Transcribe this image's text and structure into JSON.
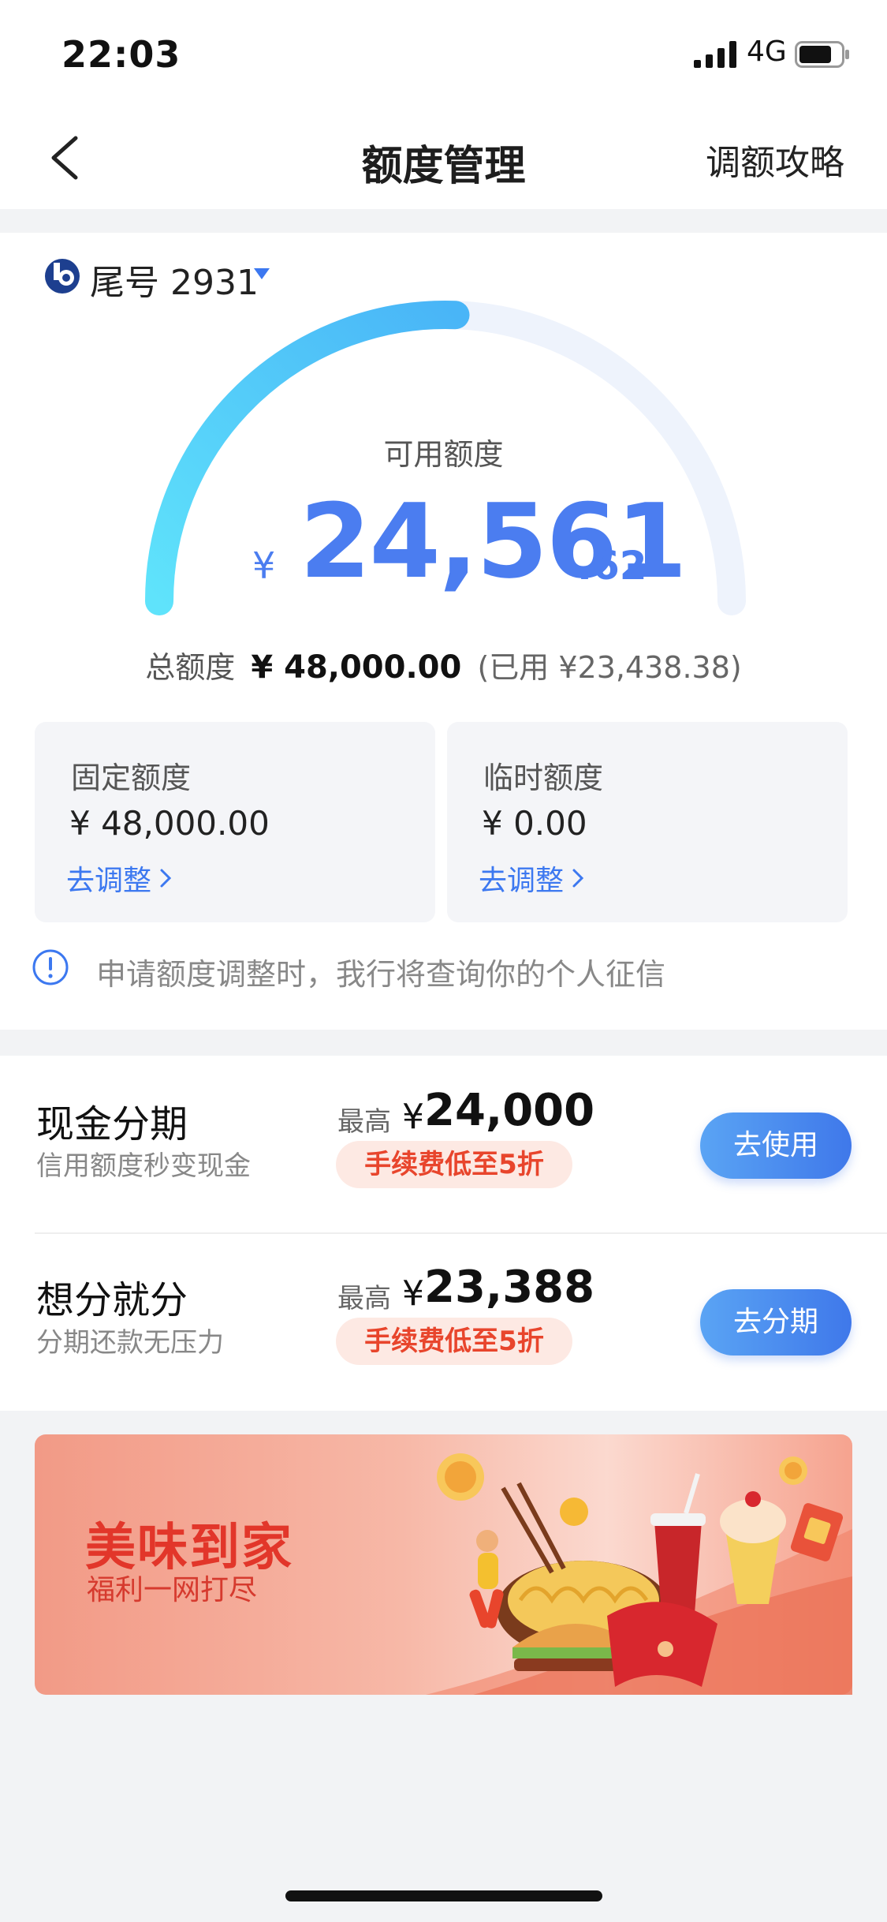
{
  "status_bar": {
    "time": "22:03",
    "network": "4G"
  },
  "nav": {
    "title": "额度管理",
    "right_link": "调额攻略"
  },
  "account": {
    "label": "尾号 2931"
  },
  "credit": {
    "available_label": "可用额度",
    "currency": "¥",
    "available_integer": "24,561",
    "available_decimal": ".62",
    "available_fraction_of_total": 0.511,
    "total_label": "总额度",
    "total_value": "¥ 48,000.00",
    "used_text": "(已用 ¥23,438.38)"
  },
  "limits": [
    {
      "title": "固定额度",
      "value": "¥ 48,000.00",
      "link": "去调整"
    },
    {
      "title": "临时额度",
      "value": "¥ 0.00",
      "link": "去调整"
    }
  ],
  "notice": "申请额度调整时，我行将查询你的个人征信",
  "products": [
    {
      "title": "现金分期",
      "subtitle": "信用额度秒变现金",
      "max_label": "最高",
      "max_currency": "¥",
      "max_value": "24,000",
      "promo": "手续费低至5折",
      "button": "去使用"
    },
    {
      "title": "想分就分",
      "subtitle": "分期还款无压力",
      "max_label": "最高",
      "max_currency": "¥",
      "max_value": "23,388",
      "promo": "手续费低至5折",
      "button": "去分期"
    }
  ],
  "banner": {
    "title": "美味到家",
    "subtitle": "福利一网打尽"
  },
  "colors": {
    "accent_blue": "#4b7df0",
    "link_blue": "#3c78f0",
    "promo_red": "#e8452c",
    "banner_red": "#e2362a"
  },
  "icons": [
    "chevron-left-icon",
    "signal-icon",
    "battery-icon",
    "bank-logo-icon",
    "caret-down-icon",
    "chevron-right-icon",
    "info-icon"
  ]
}
